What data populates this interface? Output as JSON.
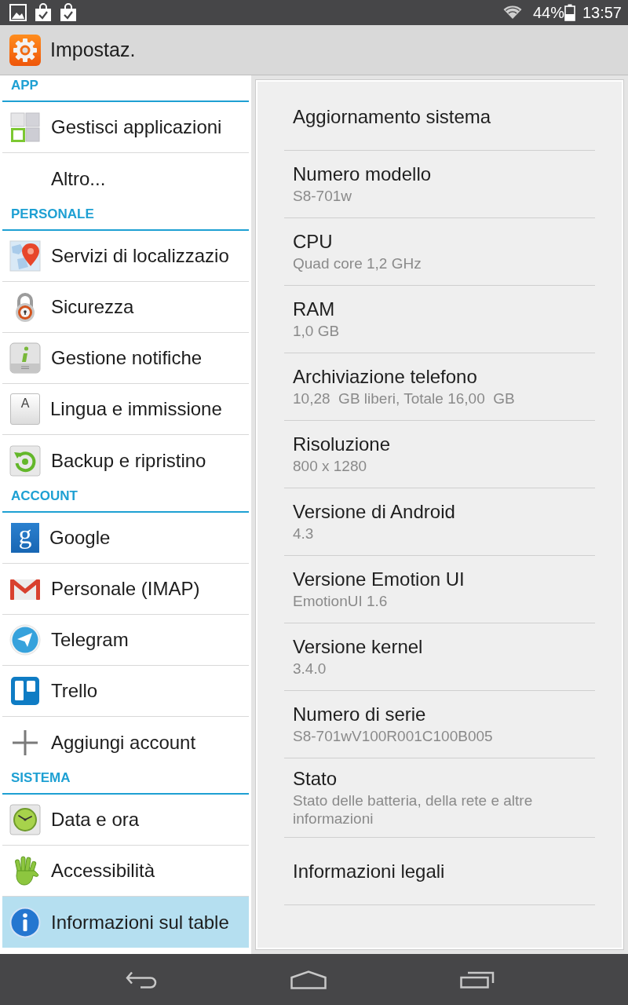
{
  "status_bar": {
    "battery": "44%",
    "time": "13:57"
  },
  "header": {
    "title": "Impostaz."
  },
  "sidebar": {
    "sections": [
      {
        "title": "APP",
        "items": [
          {
            "label": "Gestisci applicazioni",
            "selected": false
          },
          {
            "label": "Altro...",
            "selected": false
          }
        ]
      },
      {
        "title": "PERSONALE",
        "items": [
          {
            "label": "Servizi di localizzazio",
            "selected": false
          },
          {
            "label": "Sicurezza",
            "selected": false
          },
          {
            "label": "Gestione notifiche",
            "selected": false
          },
          {
            "label": "Lingua e immissione",
            "selected": false,
            "icon_text": "A"
          },
          {
            "label": "Backup e ripristino",
            "selected": false
          }
        ]
      },
      {
        "title": "ACCOUNT",
        "items": [
          {
            "label": "Google",
            "selected": false,
            "icon_text": "g"
          },
          {
            "label": "Personale (IMAP)",
            "selected": false
          },
          {
            "label": "Telegram",
            "selected": false
          },
          {
            "label": "Trello",
            "selected": false
          },
          {
            "label": "Aggiungi account",
            "selected": false
          }
        ]
      },
      {
        "title": "SISTEMA",
        "items": [
          {
            "label": "Data e ora",
            "selected": false
          },
          {
            "label": "Accessibilità",
            "selected": false
          },
          {
            "label": "Informazioni sul table",
            "selected": true
          }
        ]
      }
    ]
  },
  "detail": {
    "items": [
      {
        "title": "Aggiornamento sistema"
      },
      {
        "title": "Numero modello",
        "value": "S8-701w"
      },
      {
        "title": "CPU",
        "value": "Quad core 1,2 GHz"
      },
      {
        "title": "RAM",
        "value": "1,0 GB"
      },
      {
        "title": "Archiviazione telefono",
        "value": "10,28  GB liberi, Totale 16,00  GB"
      },
      {
        "title": "Risoluzione",
        "value": "800 x 1280"
      },
      {
        "title": "Versione di Android",
        "value": "4.3"
      },
      {
        "title": "Versione Emotion UI",
        "value": "EmotionUI 1.6"
      },
      {
        "title": "Versione kernel",
        "value": "3.4.0"
      },
      {
        "title": "Numero di serie",
        "value": "S8-701wV100R001C100B005"
      },
      {
        "title": "Stato",
        "value": "Stato delle batteria, della rete e altre informazioni"
      },
      {
        "title": "Informazioni legali"
      }
    ]
  }
}
